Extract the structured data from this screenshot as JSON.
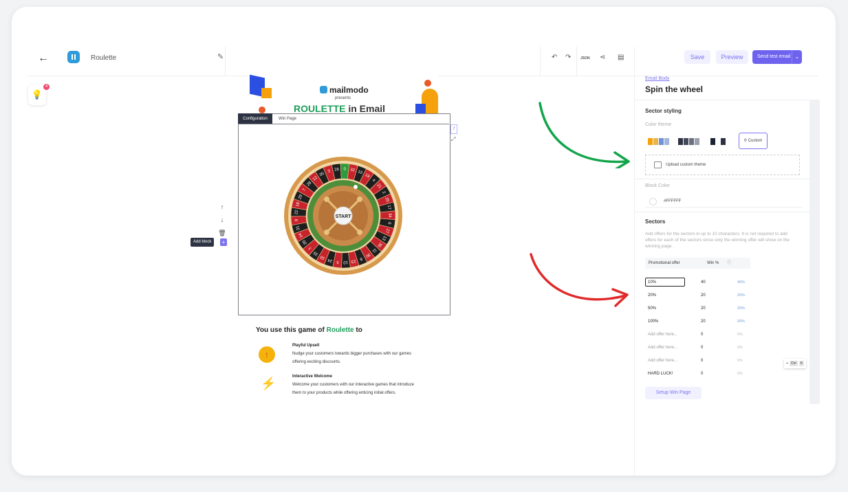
{
  "header": {
    "title": "Roulette",
    "json_label": "JSON",
    "save": "Save",
    "preview": "Preview",
    "send_test": "Send test email"
  },
  "bulb_badge": "4",
  "email": {
    "brand": "mailmodo",
    "presents": "presents",
    "hero_word": "ROULETTE",
    "hero_rest": " in Email",
    "tabs": [
      "Configuration",
      "Win Page"
    ],
    "wheel_start": "START",
    "wheel_numbers": [
      "0",
      "32",
      "15",
      "19",
      "4",
      "21",
      "2",
      "25",
      "17",
      "34",
      "6",
      "27",
      "13",
      "36",
      "11",
      "30",
      "8",
      "23",
      "10",
      "5",
      "24",
      "16",
      "33",
      "1",
      "20",
      "14",
      "31",
      "9",
      "22",
      "18",
      "29",
      "7",
      "28",
      "12",
      "35",
      "3",
      "26"
    ],
    "add_block": "Add block",
    "use_prefix": "You use this game of ",
    "use_word": "Roulette",
    "use_suffix": " to",
    "features": [
      {
        "title": "Playful Upsell",
        "text": "Nudge your customers towards bigger purchases with our games offering exciting discounts.",
        "icon": "arrow-up-icon"
      },
      {
        "title": "Interactive Welcome",
        "text": "Welcome your customers with our interactive games that introduce them to your products while offering enticing initial offers.",
        "icon": "bolt-icon"
      }
    ]
  },
  "panel": {
    "breadcrumb": "Email Body",
    "heading": "Spin the wheel",
    "sector_styling": "Sector styling",
    "color_theme": "Color theme",
    "themes": [
      [
        "#f5a10b",
        "#e8b54a",
        "#6f93d6",
        "#a0b4dd"
      ],
      [
        "#2d3343",
        "#44495a",
        "#6b7080",
        "#9aa0ad"
      ],
      [
        "#1c2333",
        "#2d3343"
      ]
    ],
    "custom": "Custom",
    "upload_theme": "Upload custom theme",
    "block_color_label": "Block Color",
    "block_color_value": "#FFFFFF",
    "sectors_title": "Sectors",
    "sectors_desc": "Add offers for the sectors in up to 10 characters. It is not required to add offers for each of the sectors since only the winning offer will show on the winning page.",
    "col_offer": "Promotional offer",
    "col_win": "Win %",
    "rows": [
      {
        "offer": "10%",
        "win": "40",
        "pct": "40%",
        "placeholder": false
      },
      {
        "offer": "20%",
        "win": "20",
        "pct": "20%",
        "placeholder": false
      },
      {
        "offer": "50%",
        "win": "20",
        "pct": "20%",
        "placeholder": false
      },
      {
        "offer": "100%",
        "win": "20",
        "pct": "20%",
        "placeholder": false
      },
      {
        "offer": "Add offer here...",
        "win": "0",
        "pct": "0%",
        "placeholder": true
      },
      {
        "offer": "Add offer here...",
        "win": "0",
        "pct": "0%",
        "placeholder": true
      },
      {
        "offer": "Add offer here...",
        "win": "0",
        "pct": "0%",
        "placeholder": true
      },
      {
        "offer": "HARD LUCK!",
        "win": "0",
        "pct": "0%",
        "placeholder": false
      }
    ],
    "setup_win": "Setup Win Page",
    "kbd_plus": "+",
    "kbd_ctrl": "Ctrl",
    "kbd_k": "K"
  },
  "colors": {
    "accent": "#6e63ee",
    "green_arrow": "#12a54a",
    "red_arrow": "#e02a2a",
    "wheel_red": "#c8232c",
    "wheel_black": "#1e1e1e",
    "wheel_green": "#2e9b3a"
  }
}
